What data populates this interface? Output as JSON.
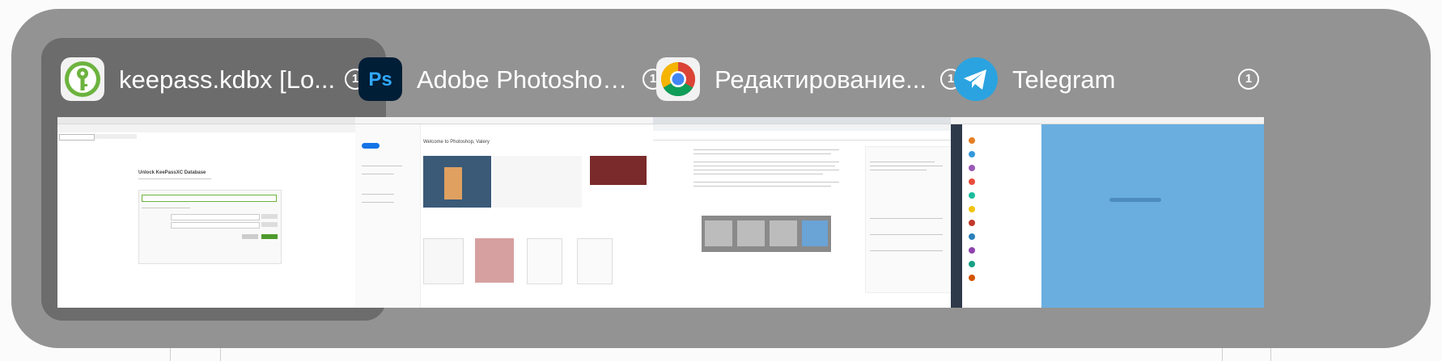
{
  "switcher": {
    "windows": [
      {
        "app": "KeePassXC",
        "icon": "keepassxc-key-icon",
        "title": "keepass.kdbx [Lo...",
        "window_count": "1",
        "selected": true,
        "thumb_text": "Unlock KeePassXC Database"
      },
      {
        "app": "Adobe Photoshop",
        "icon": "photoshop-icon",
        "title": "Adobe Photoshop...",
        "window_count": "1",
        "selected": false,
        "thumb_text": "Welcome to Photoshop, Valery"
      },
      {
        "app": "Google Chrome",
        "icon": "chrome-icon",
        "title": "Редактирование...",
        "window_count": "1",
        "selected": false,
        "thumb_text": ""
      },
      {
        "app": "Telegram",
        "icon": "telegram-icon",
        "title": "Telegram",
        "window_count": "1",
        "selected": false,
        "thumb_text": ""
      }
    ]
  },
  "colors": {
    "switcher_bg": "#939393",
    "selected_card_bg": "#6c6c6c",
    "telegram_blue": "#2aa3e0",
    "photoshop_blue": "#31a8ff"
  }
}
